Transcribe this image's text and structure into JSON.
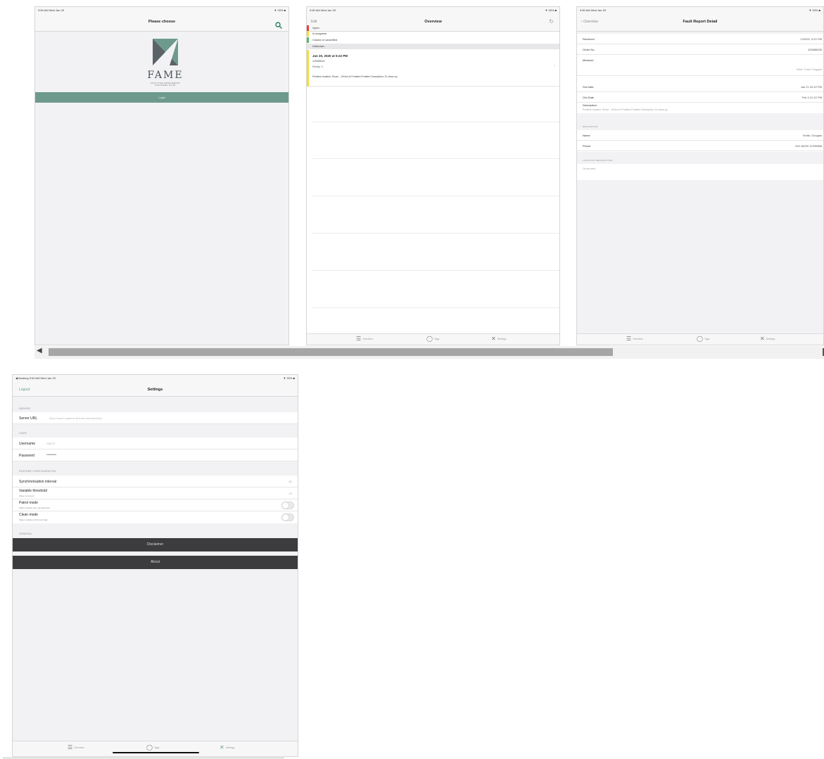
{
  "login_screen": {
    "status_left": "9:50 AM  Wed Jan 29",
    "status_right": "▼ 93% ■",
    "title": "Please choose",
    "logo_text": "FAME",
    "logo_subtitle_1": "FACILITIES MANAGEMENT",
    "logo_subtitle_2": "SOFTWARE SUITE",
    "login_label": "Login"
  },
  "overview_screen": {
    "status_left": "9:50 AM  Wed Jan 29",
    "status_right": "▼ 93% ■",
    "edit_label": "Edit",
    "title": "Overview",
    "legend": [
      {
        "label": "Open",
        "color": "#e04343"
      },
      {
        "label": "In progress",
        "color": "#f0df3c"
      },
      {
        "label": "Closed or cancelled",
        "color": "#59b86a"
      }
    ],
    "unknown_label": "Unknown",
    "ticket": {
      "date": "Jan 20, 2020 at 5:22 PM",
      "order": "425585639",
      "priority": "Priority: 2",
      "description": "Problem location: Room - 1/Kind of Problem:Problem Description: To clean up"
    },
    "tabs": [
      "Overview",
      "Tags",
      "Settings"
    ]
  },
  "detail_screen": {
    "status_left": "9:50 AM  Wed Jan 29",
    "status_right": "▼ 93% ■",
    "back_label": "Overview",
    "title": "Fault Report Detail",
    "rows": [
      {
        "key": "Received",
        "value": "1/20/20, 5:22 PM"
      },
      {
        "key": "Order No.",
        "value": "425585639"
      },
      {
        "key": "Measure",
        "value": ""
      },
      {
        "key": "Measure value",
        "value": "Toilet: Toilet Clogged"
      },
      {
        "key": "S/a Date",
        "value": "Jan 21  02:22 PM"
      },
      {
        "key": "O/a Date",
        "value": "Feb 3  01:22 PM"
      }
    ],
    "description_label": "Description",
    "description_text": "Problem location: Room - 1/Kind of Problem:Problem Description: To clean up",
    "requestor_section": "REQUESTOR",
    "requestor_rows": [
      {
        "key": "Name",
        "value": "Smith, Douglas"
      },
      {
        "key": "Phone",
        "value": "040 45209 12335588"
      }
    ],
    "location_section": "LOCATION DESCRIPTION",
    "location_text": "Ok we went",
    "tabs": [
      "Overview",
      "Tags",
      "Settings"
    ]
  },
  "settings_screen": {
    "status_left": "◀ Booking  9:50 AM  Wed Jan 29",
    "status_right": "▼ 93% ■",
    "logout_label": "Logout",
    "title": "Settings",
    "server_section": "SERVER",
    "server_url_label": "Server URL",
    "server_url_value": "https://www.myfame.de/international/fame/",
    "user_section": "USER",
    "username_label": "Username",
    "username_value": "SMITH",
    "password_label": "Password",
    "password_value": "••••••••",
    "feature_section": "FEATURE CONFIGURATION",
    "sync_label": "Synchronisation interval",
    "sync_value": "60",
    "threshold_label": "Variable threshold",
    "threshold_sub": "Value in percent",
    "threshold_value": "20",
    "patrol_label": "Patrol mode",
    "patrol_sub": "Status update upon tag detection",
    "clean_label": "Clean mode",
    "clean_sub": "Status update of all found tags",
    "general_section": "GENERAL",
    "disclaimer_label": "Disclaimer",
    "about_label": "About",
    "tabs": [
      "Overview",
      "Tags",
      "Settings"
    ]
  },
  "scrollbar": {
    "left_arrow": "◀",
    "thumb_fraction": 0.73
  }
}
